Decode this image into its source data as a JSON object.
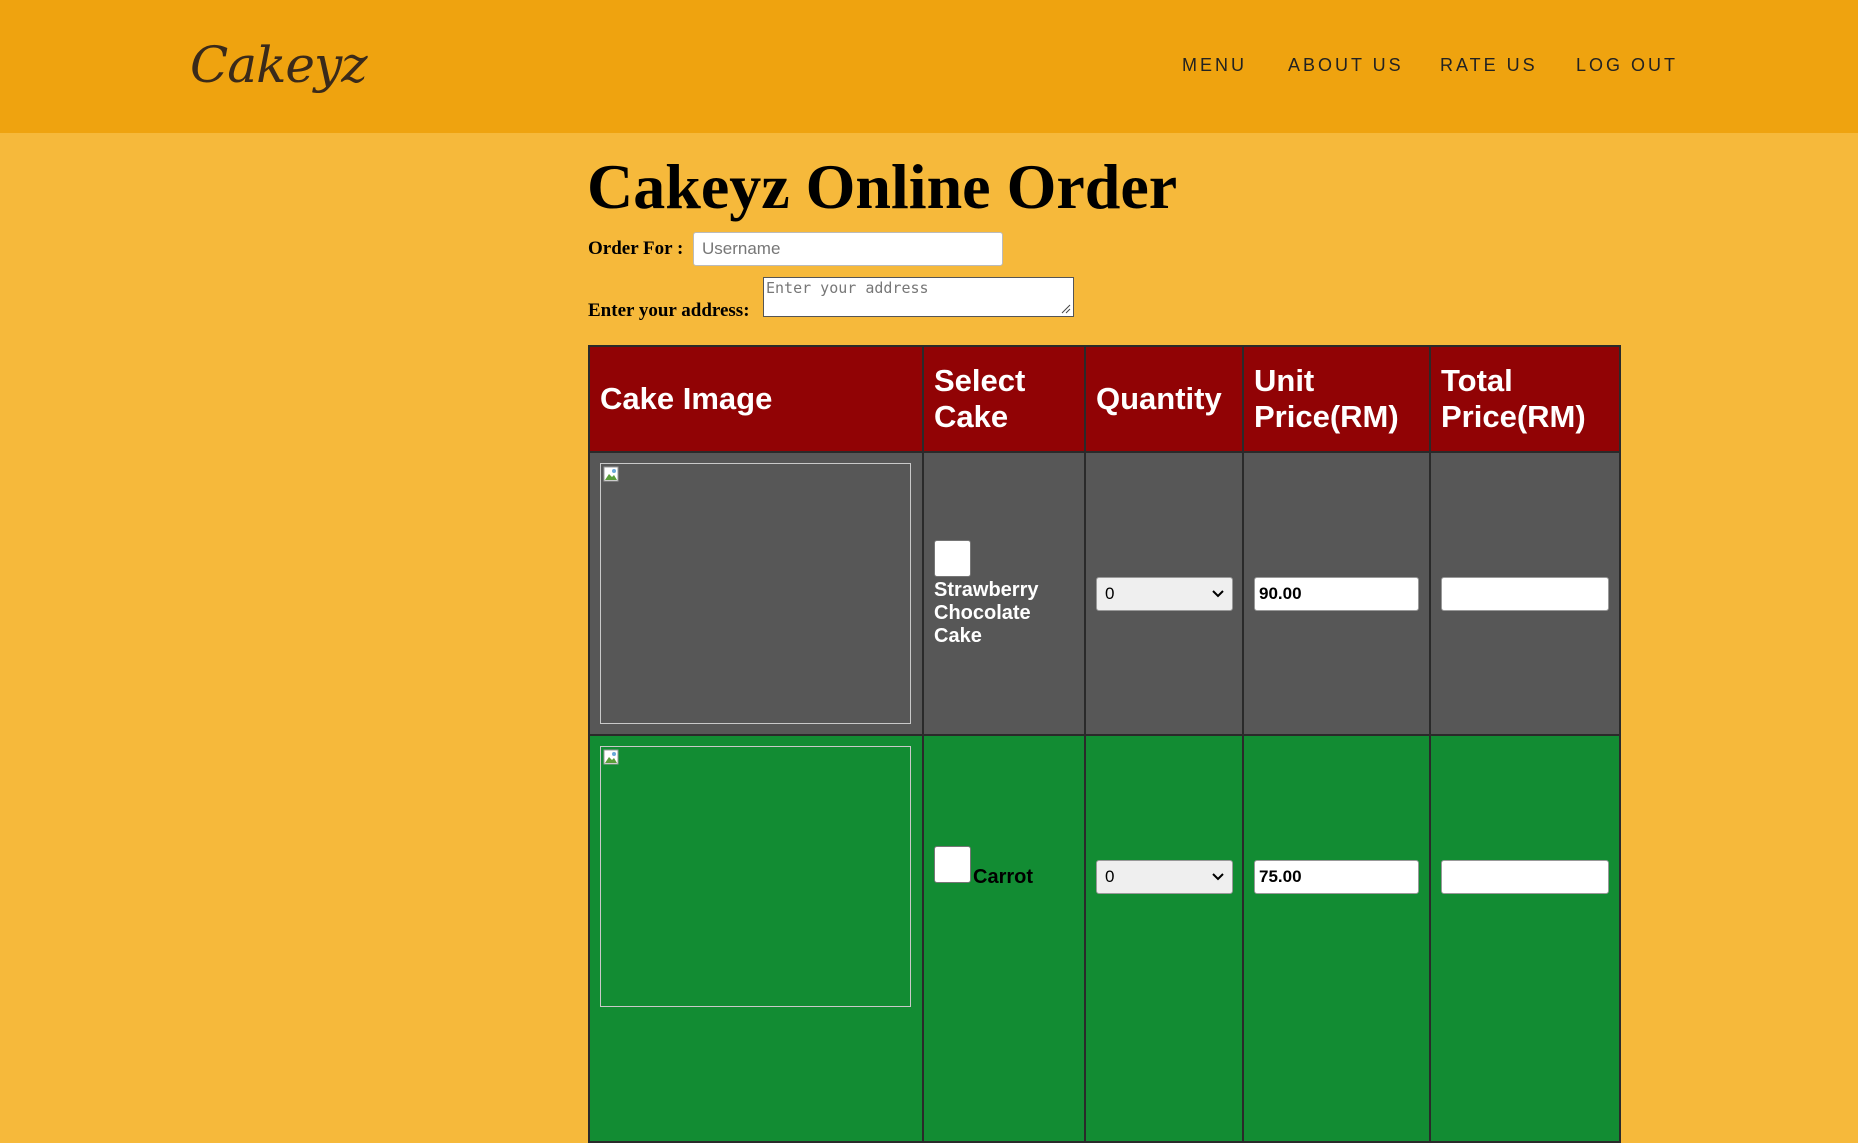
{
  "header": {
    "logo": "Cakeyz",
    "nav": [
      "MENU",
      "ABOUT US",
      "RATE US",
      "LOG OUT"
    ]
  },
  "form": {
    "title": "Cakeyz Online Order",
    "order_for_label": "Order For :",
    "username_placeholder": "Username",
    "address_label": "Enter your address:",
    "address_placeholder": "Enter your address"
  },
  "table": {
    "headers": [
      "Cake Image",
      "Select Cake",
      "Quantity",
      "Unit Price(RM)",
      "Total Price(RM)"
    ],
    "rows": [
      {
        "cake": "Strawberry Chocolate Cake",
        "quantity": "0",
        "unit_price": "90.00",
        "total_price": "",
        "row_color": "#575757"
      },
      {
        "cake": "Carrot",
        "quantity": "0",
        "unit_price": "75.00",
        "total_price": "",
        "row_color": "#128c33"
      }
    ]
  },
  "colors": {
    "header_bar": "#efa30f",
    "page_background": "#f6b93b",
    "table_header": "#910305"
  }
}
